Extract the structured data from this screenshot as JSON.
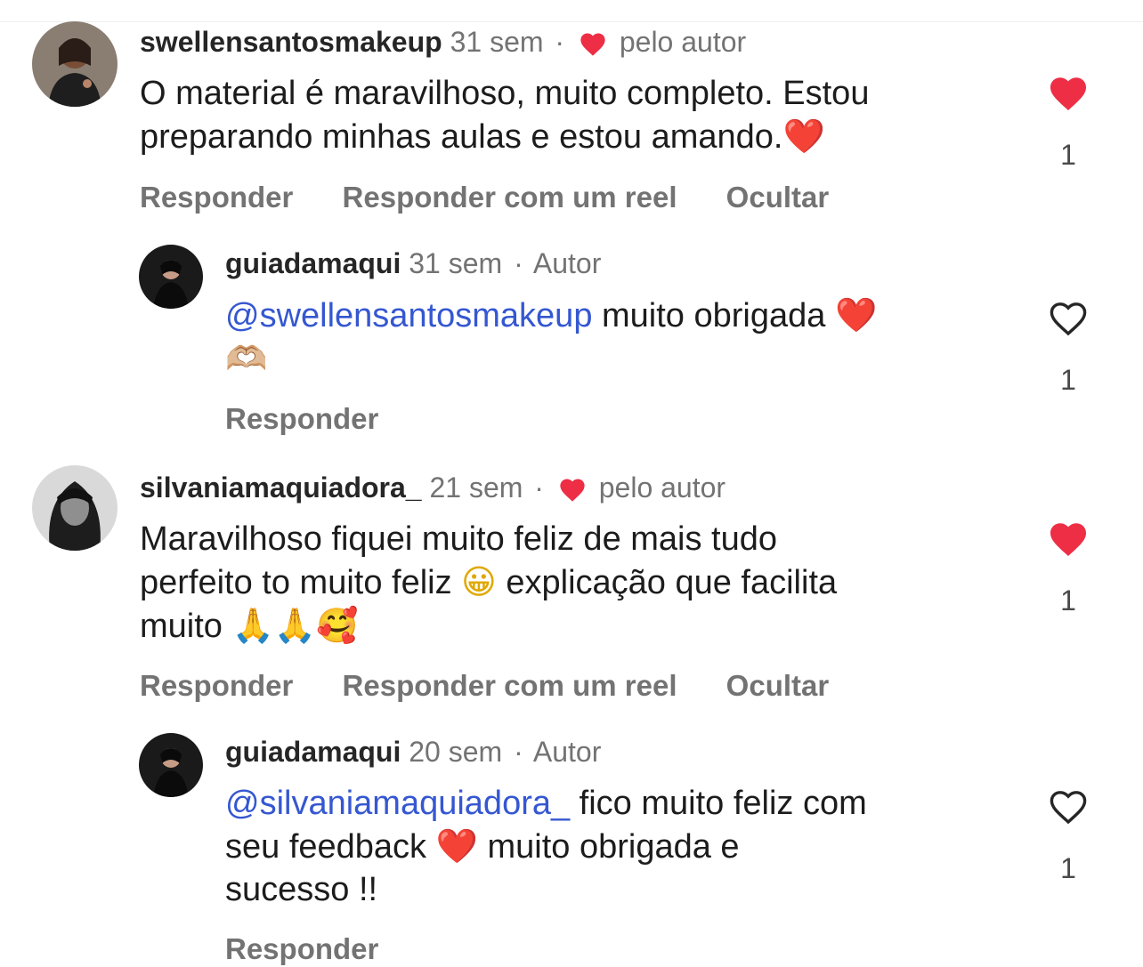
{
  "comments": [
    {
      "username": "swellensantosmakeup",
      "time": "31 sem",
      "separator": "·",
      "liked_by_author_label": "pelo autor",
      "text_line1": "O material é maravilhoso, muito completo. Estou",
      "text_line2": "preparando minhas aulas e estou amando.",
      "emoji_end": "❤️",
      "like_count": "1",
      "liked": true,
      "actions": [
        "Responder",
        "Responder com um reel",
        "Ocultar"
      ],
      "reply": {
        "username": "guiadamaqui",
        "time": "31 sem",
        "separator": "·",
        "role": "Autor",
        "mention": "@swellensantosmakeup",
        "text": " muito obrigada ",
        "emoji1": "❤️",
        "emoji2": "🫶🏼",
        "like_count": "1",
        "liked": false,
        "action": "Responder"
      }
    },
    {
      "username": "silvaniamaquiadora_",
      "time": "21 sem",
      "separator": "·",
      "liked_by_author_label": "pelo autor",
      "text_line1": "Maravilhoso fiquei muito feliz de mais tudo",
      "text_line2a": "perfeito to muito feliz ",
      "emoji_mid": "😀",
      "text_line2b": " explicação que facilita",
      "text_line3": "muito ",
      "emoji_end": "🙏🙏🥰",
      "like_count": "1",
      "liked": true,
      "actions": [
        "Responder",
        "Responder com um reel",
        "Ocultar"
      ],
      "reply": {
        "username": "guiadamaqui",
        "time": "20 sem",
        "separator": "·",
        "role": "Autor",
        "mention": "@silvaniamaquiadora_",
        "text_line1": " fico muito feliz com",
        "text_line2a": "seu feedback ",
        "emoji1": "❤️",
        "text_line2b": " muito obrigada e",
        "text_line3": "sucesso !!",
        "like_count": "1",
        "liked": false,
        "action": "Responder"
      }
    }
  ],
  "colors": {
    "heart_red": "#ed2e45",
    "meta_gray": "#737373",
    "mention_blue": "#3557d1",
    "text_dark": "#1c1c1c"
  }
}
